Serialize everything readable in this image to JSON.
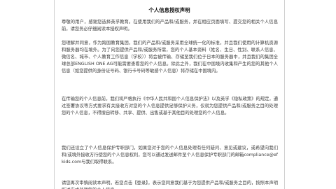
{
  "dialog": {
    "title": "个人信息授权声明",
    "paragraphs": [
      "尊敬的用户，感谢您选择英孚教育。在使用我们的产品和/或服务，并在相应页面填写、提交您的相关个人信息前，请您务必仔细阅读本授权声明。",
      "您理解并同意，作为跨国教育集团，我们的产品和/或服务采用全球统一化的标准，并且我们使用的计算机资源和服务器均在境外。为了向您提供产品和/或服务所需，您的个人基本资料（姓名、生日、性别、联系人信息、微信名、城市、个人教育工作信息（学校））将会被传输、存储至我们位于日本的服务器中，并且我们的集团全球总部ENGLISH ONE AG可能需要查看您的个人信息。除此之外，我们在中国境内收集和产生的您的其他个人信息（如您提供的身份证号码、银行卡号码等敏感个人信息）将存储在中国境内。",
      "在传输您的个人信息前，我们将严格执行《中华人民共和国个人信息保护法》以及英孚《隐私政策》的规定，通过签署协议等方式要求有关接收方对您的个人信息提供足够保护义务，仅就为您提供产品和/或服务之目的处理您的个人信息，不得擅自转移、共享、提供、出售或基于其他目的处理您的个人信息。",
      "我们还设立了个人信息保护专职部门，如果您对于您的个人信息处理有任何疑问、意见或建议，或希望向我们和/或境外接收方行使您的个人信息权利，您可以通过发送邮件至个人信息保护专职部门的邮箱compliance@efkids.com与我们取得联系。",
      "请您再次审慎阅读本声明，若您点击【登录】，表示您同意我们基于为您提供产品和/或服务之目的，按照本声明所述方式处理您的个人信息。"
    ]
  }
}
